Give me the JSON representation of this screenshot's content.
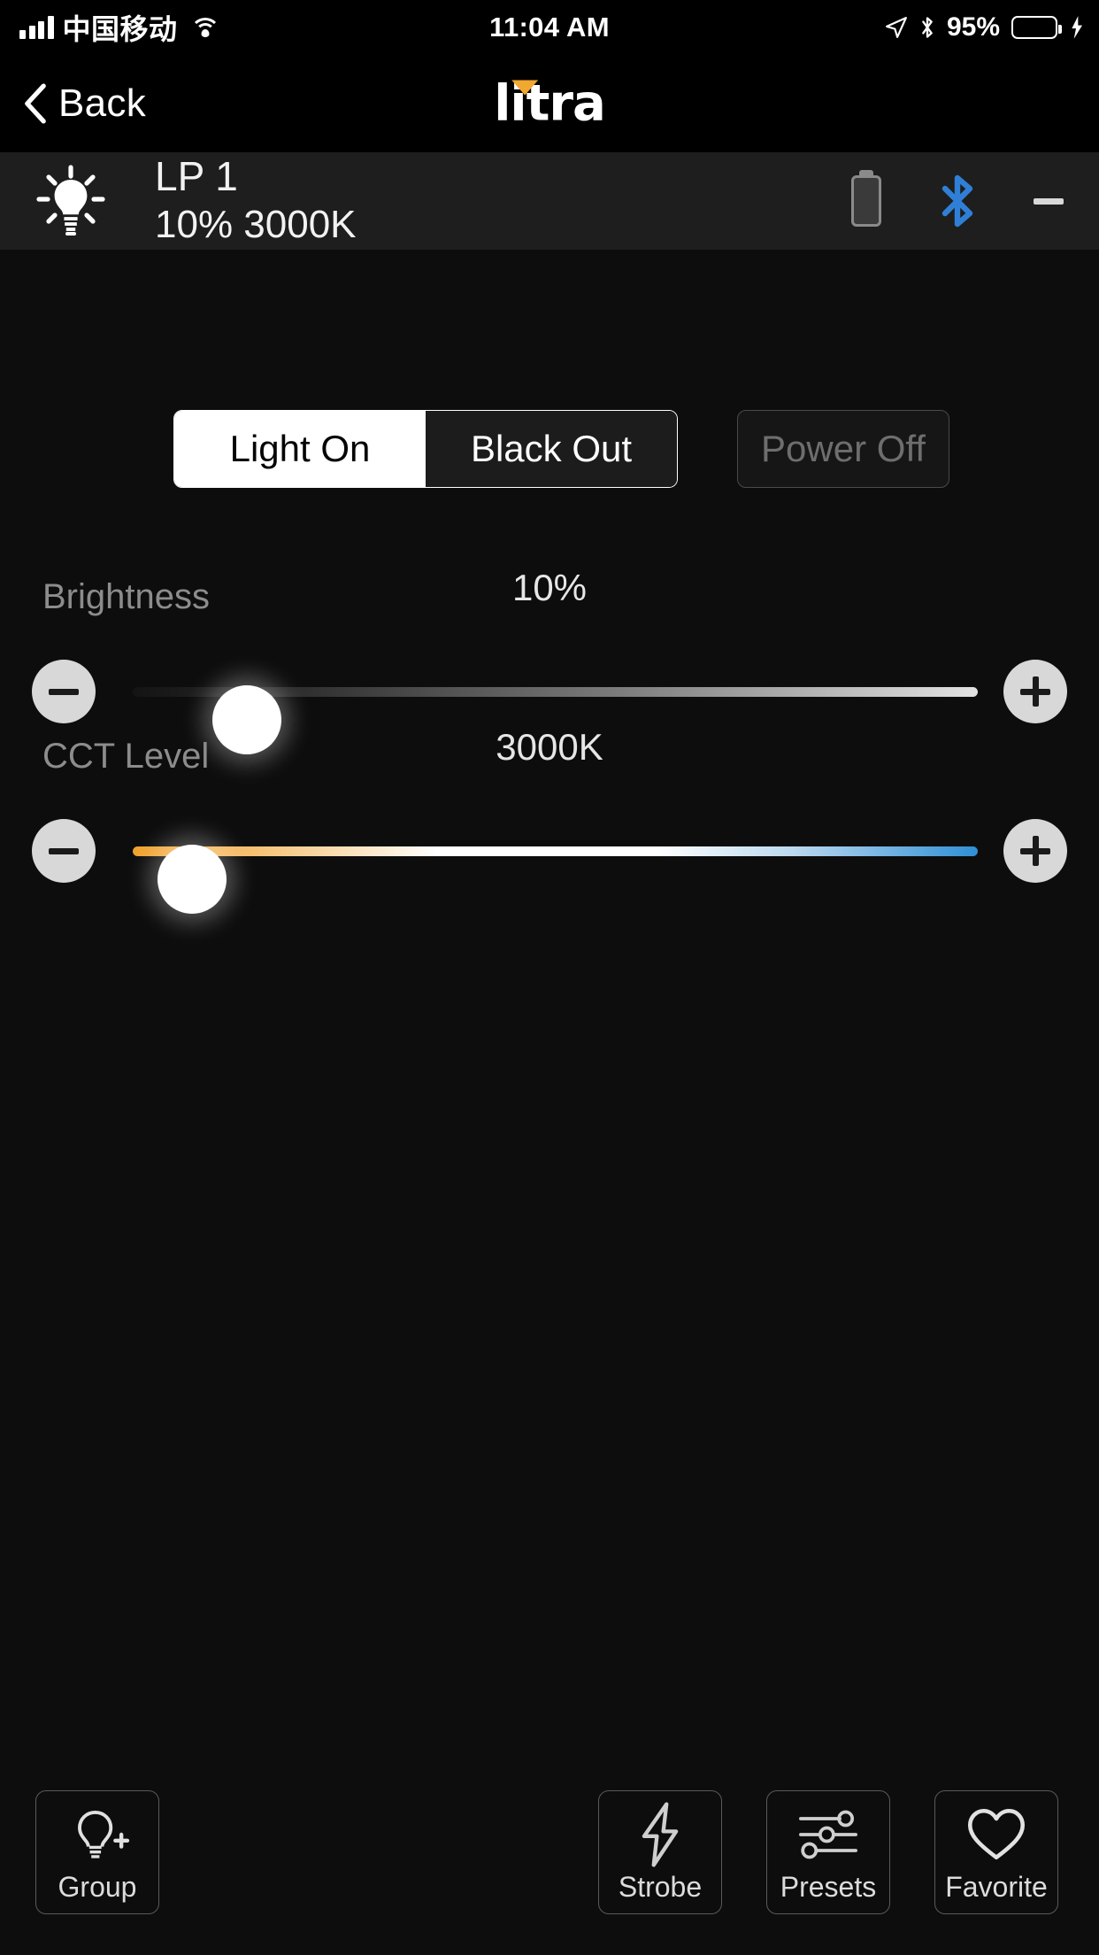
{
  "status_bar": {
    "carrier": "中国移动",
    "time": "11:04 AM",
    "battery_percent": "95%",
    "icons": [
      "signal-icon",
      "wifi-icon",
      "location-arrow-icon",
      "bluetooth-icon",
      "battery-icon",
      "charging-bolt-icon"
    ]
  },
  "nav": {
    "back_label": "Back",
    "brand": "litra"
  },
  "device": {
    "name": "LP 1",
    "status": "10% 3000K",
    "bulb_icon": "lightbulb-icon",
    "battery_icon": "battery-vertical-icon",
    "bluetooth_icon": "bluetooth-icon",
    "dash_icon": "minus-icon"
  },
  "modes": {
    "light_on": "Light On",
    "black_out": "Black Out",
    "power_off": "Power Off",
    "selected": "Light On"
  },
  "brightness": {
    "label": "Brightness",
    "value": "10%",
    "percent": 10,
    "minus": "minus-icon",
    "plus": "plus-icon"
  },
  "cct": {
    "label": "CCT Level",
    "value": "3000K",
    "percent": 3,
    "minus": "minus-icon",
    "plus": "plus-icon"
  },
  "toolbar": {
    "group": "Group",
    "strobe": "Strobe",
    "presets": "Presets",
    "favorite": "Favorite"
  },
  "colors": {
    "background": "#0d0d0d",
    "device_row": "#1e1e1e",
    "accent_amber": "#f0a830",
    "bluetooth_blue": "#2f7fd6",
    "battery_green": "#6ee06e",
    "cct_warm": "#f0a12c",
    "cct_cool": "#2f8fd6"
  }
}
